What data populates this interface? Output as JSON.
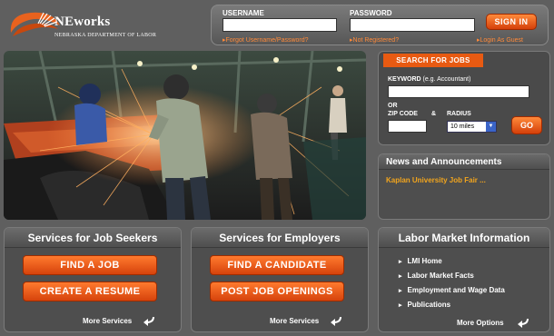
{
  "brand": {
    "name": "NEworks",
    "subtitle": "NEBRASKA DEPARTMENT OF LABOR"
  },
  "login": {
    "username_label": "USERNAME",
    "password_label": "PASSWORD",
    "signin_label": "SIGN IN",
    "forgot_link": "Forgot Username/Password?",
    "register_link": "Not Registered?",
    "guest_link": "Login As Guest"
  },
  "search": {
    "tab_label": "SEARCH FOR JOBS",
    "keyword_label": "KEYWORD",
    "keyword_hint": "(e.g. Accountant)",
    "or_label": "OR",
    "zip_label": "ZIP CODE",
    "amp": "&",
    "radius_label": "RADIUS",
    "radius_value": "10 miles",
    "go_label": "GO"
  },
  "news": {
    "title": "News and Announcements",
    "items": [
      "Kaplan University Job Fair ..."
    ]
  },
  "job_seekers": {
    "title": "Services for Job Seekers",
    "button1": "FIND A JOB",
    "button2": "CREATE A RESUME",
    "more": "More Services"
  },
  "employers": {
    "title": "Services for Employers",
    "button1": "FIND A CANDIDATE",
    "button2": "POST JOB OPENINGS",
    "more": "More Services"
  },
  "labor_market": {
    "title": "Labor Market Information",
    "links": [
      "LMI Home",
      "Labor Market Facts",
      "Employment and Wage Data",
      "Publications"
    ],
    "more": "More Options"
  },
  "colors": {
    "accent": "#e85a12",
    "news_link": "#f2a51d",
    "panel_bg": "#4e4e4e",
    "page_bg": "#5f5f5f"
  }
}
